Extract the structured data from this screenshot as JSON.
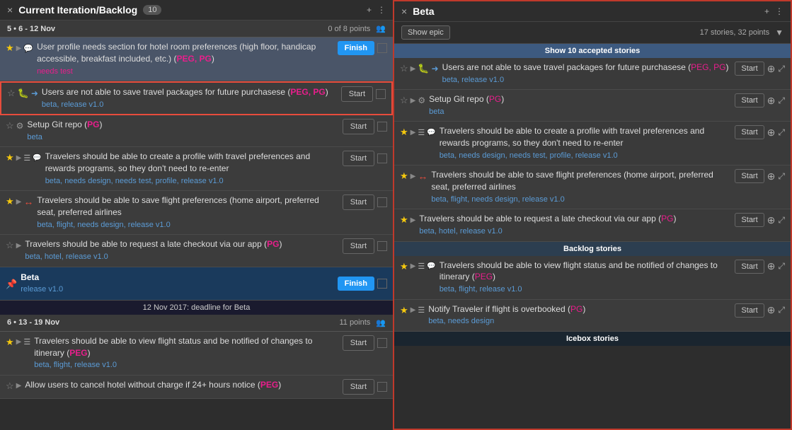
{
  "left": {
    "header": {
      "title": "Current Iteration/Backlog",
      "close_label": "×",
      "count": "10",
      "actions": [
        "+",
        "⋮"
      ]
    },
    "iteration1": {
      "label": "5 • 6 - 12 Nov",
      "points": "0 of 8 points",
      "stories": [
        {
          "id": "s1",
          "star": true,
          "has_comment": true,
          "type": "story",
          "title": "User profile needs section for hotel room preferences (high floor, handicap accessible, breakfast included, etc.) (PEG, PG)",
          "label": "needs test",
          "label_color": "pink",
          "action": "Finish"
        },
        {
          "id": "s2",
          "star": false,
          "type": "bug",
          "title": "Users are not able to save travel packages for future purchasese (PEG, PG)",
          "labels": "beta, release v1.0",
          "action": "Start"
        },
        {
          "id": "s3",
          "star": false,
          "type": "gear",
          "title": "Setup Git repo (PG)",
          "labels": "beta",
          "action": "Start"
        },
        {
          "id": "s4",
          "star": true,
          "has_list": true,
          "has_comment": true,
          "type": "story",
          "title": "Travelers should be able to create a profile with travel preferences and rewards programs, so they don't need to re-enter",
          "labels": "beta, needs design, needs test, profile, release v1.0",
          "action": "Start"
        },
        {
          "id": "s5",
          "star": true,
          "type": "story",
          "has_arrow": true,
          "title": "Travelers should be able to save flight preferences (home airport, preferred seat, preferred airlines",
          "labels": "beta, flight, needs design, release v1.0",
          "action": "Start"
        },
        {
          "id": "s6",
          "star": false,
          "type": "story",
          "title": "Travelers should be able to request a late checkout via our app (PG)",
          "labels": "beta, hotel, release v1.0",
          "action": "Start"
        }
      ]
    },
    "epic_row": {
      "title": "Beta",
      "labels": "release v1.0",
      "action": "Finish"
    },
    "deadline": "12 Nov 2017: deadline for Beta",
    "iteration2": {
      "label": "6 • 13 - 19 Nov",
      "points": "11 points",
      "stories": [
        {
          "id": "s7",
          "star": true,
          "has_list": true,
          "type": "story",
          "title": "Travelers should be able to view flight status and be notified of changes to itinerary (PEG)",
          "labels": "beta, flight, release v1.0",
          "action": "Start"
        },
        {
          "id": "s8",
          "star": false,
          "type": "story",
          "title": "Allow users to cancel hotel without charge if 24+ hours notice (PEG)",
          "action": "Start"
        }
      ]
    }
  },
  "right": {
    "header": {
      "title": "Beta",
      "close_label": "×",
      "actions": [
        "+",
        "⋮"
      ]
    },
    "meta": {
      "show_epic": "Show epic",
      "story_count": "17 stories, 32 points"
    },
    "accepted_section": {
      "label": "Show 10 accepted stories"
    },
    "stories": [
      {
        "id": "rs1",
        "star": false,
        "has_comment": true,
        "type": "bug",
        "title": "Users are not able to save travel packages for future purchasese (PEG, PG)",
        "labels": "beta, release v1.0",
        "action": "Start"
      },
      {
        "id": "rs2",
        "star": false,
        "type": "gear",
        "title": "Setup Git repo (PG)",
        "labels": "beta",
        "action": "Start"
      },
      {
        "id": "rs3",
        "star": true,
        "has_list": true,
        "has_comment": true,
        "type": "story",
        "title": "Travelers should be able to create a profile with travel preferences and rewards programs, so they don't need to re-enter",
        "labels": "beta, needs design, needs test, profile, release v1.0",
        "action": "Start"
      },
      {
        "id": "rs4",
        "star": true,
        "has_arrow": true,
        "type": "story",
        "title": "Travelers should be able to save flight preferences (home airport, preferred seat, preferred airlines",
        "labels": "beta, flight, needs design, release v1.0",
        "action": "Start"
      },
      {
        "id": "rs5",
        "star": true,
        "type": "story",
        "title": "Travelers should be able to request a late checkout via our app (PG)",
        "labels": "beta, hotel, release v1.0",
        "action": "Start"
      }
    ],
    "backlog_section": {
      "label": "Backlog stories"
    },
    "backlog_stories": [
      {
        "id": "rb1",
        "star": true,
        "has_list": true,
        "has_comment": true,
        "type": "story",
        "title": "Travelers should be able to view flight status and be notified of changes to itinerary (PEG)",
        "labels": "beta, flight, release v1.0",
        "action": "Start"
      },
      {
        "id": "rb2",
        "star": true,
        "has_list": true,
        "type": "story",
        "title": "Notify Traveler if flight is overbooked (PG)",
        "labels": "beta, needs design",
        "action": "Start"
      }
    ],
    "icebox_section": {
      "label": "Icebox stories"
    }
  }
}
